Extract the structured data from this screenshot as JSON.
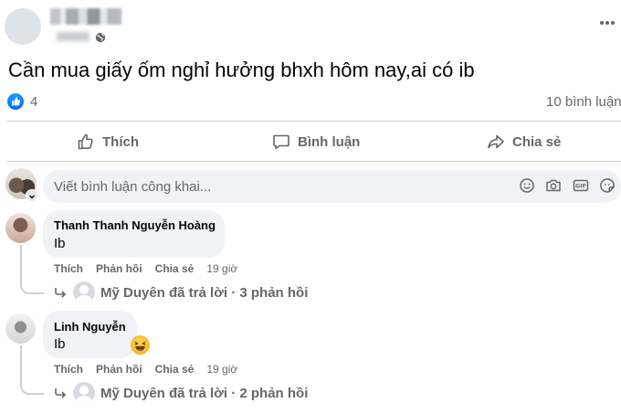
{
  "post": {
    "text": "Cần mua giấy ốm nghỉ hưởng bhxh hôm nay,ai có ib",
    "reaction_count": "4",
    "comment_count": "10 bình luận"
  },
  "actions": {
    "like": "Thích",
    "comment": "Bình luận",
    "share": "Chia sẻ"
  },
  "composer": {
    "placeholder": "Viết bình luận công khai..."
  },
  "comments": [
    {
      "author": "Thanh Thanh Nguyễn Hoàng",
      "text": "Ib",
      "like": "Thích",
      "reply": "Phản hồi",
      "share": "Chia sẻ",
      "time": "19 giờ",
      "replies_summary": "Mỹ Duyên đã trả lời · 3 phản hồi"
    },
    {
      "author": "Linh Nguyễn",
      "text": "Ib",
      "like": "Thích",
      "reply": "Phản hồi",
      "share": "Chia sẻ",
      "time": "19 giờ",
      "replies_summary": "Mỹ Duyên đã trả lời · 2 phản hồi"
    }
  ],
  "icons": {
    "post_visibility": "globe-icon",
    "more": "more-icon",
    "reaction": "like-icon",
    "composer": [
      "emoji-icon",
      "camera-icon",
      "gif-icon",
      "sticker-icon"
    ],
    "comment_reaction": "laughing-emoji-icon"
  },
  "colors": {
    "accent": "#0866ff",
    "secondary_text": "#65676b",
    "bubble": "#f0f2f5"
  }
}
